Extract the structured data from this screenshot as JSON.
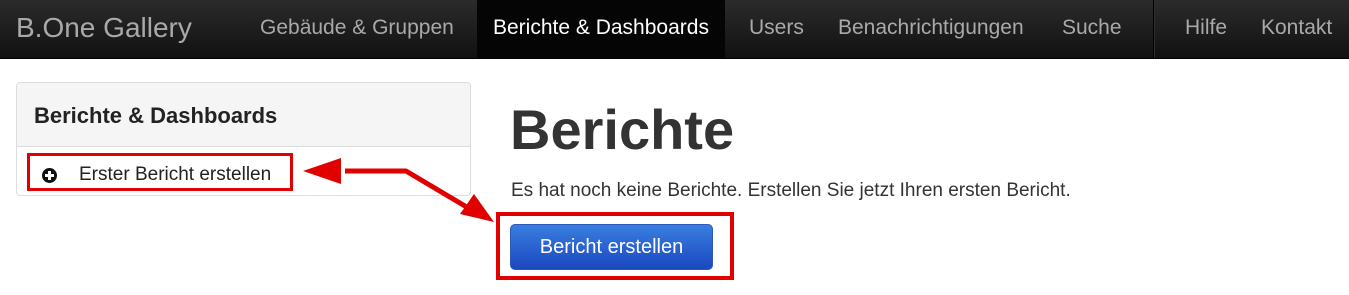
{
  "navbar": {
    "brand": "B.One Gallery",
    "items": [
      {
        "label": "Gebäude & Gruppen",
        "active": false
      },
      {
        "label": "Berichte & Dashboards",
        "active": true
      },
      {
        "label": "Users",
        "active": false
      },
      {
        "label": "Benachrichtigungen",
        "active": false
      },
      {
        "label": "Suche",
        "active": false
      }
    ],
    "right_items": [
      {
        "label": "Hilfe"
      },
      {
        "label": "Kontakt"
      }
    ]
  },
  "sidebar": {
    "title": "Berichte & Dashboards",
    "items": [
      {
        "label": "Erster Bericht erstellen",
        "icon": "plus-circle-icon"
      }
    ]
  },
  "main": {
    "title": "Berichte",
    "message": "Es hat noch keine Berichte. Erstellen Sie jetzt Ihren ersten Bericht.",
    "create_button_label": "Bericht erstellen"
  },
  "colors": {
    "navbar_bg": "#111111",
    "active_nav_bg": "#050505",
    "annotation": "#e00000",
    "primary_button": "#2a5fd0"
  }
}
